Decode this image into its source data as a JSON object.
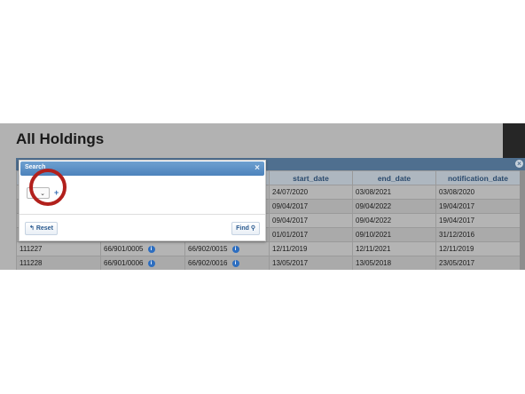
{
  "page": {
    "title": "All Holdings"
  },
  "grid": {
    "headers": [
      "",
      "",
      "",
      "start_date",
      "end_date",
      "notification_date"
    ],
    "rows": [
      [
        "",
        "",
        "",
        "24/07/2020",
        "03/08/2021",
        "03/08/2020"
      ],
      [
        "",
        "",
        "",
        "09/04/2017",
        "09/04/2022",
        "19/04/2017"
      ],
      [
        "",
        "",
        "",
        "09/04/2017",
        "09/04/2022",
        "19/04/2017"
      ],
      [
        "",
        "",
        "",
        "01/01/2017",
        "09/10/2021",
        "31/12/2016"
      ],
      [
        "111227",
        "66/901/0005",
        "66/902/0015",
        "12/11/2019",
        "12/11/2021",
        "12/11/2019"
      ],
      [
        "111228",
        "66/901/0006",
        "66/902/0016",
        "13/05/2017",
        "13/05/2018",
        "23/05/2017"
      ]
    ]
  },
  "search_dialog": {
    "title": "Search",
    "close_symbol": "×",
    "field_value": "a",
    "add_symbol": "+",
    "reset_icon": "↰",
    "reset_label": "Reset",
    "find_label": "Find",
    "find_icon": "⚲"
  },
  "icons": {
    "info_icon": "i",
    "chevron_down": "⌄"
  },
  "colors": {
    "highlight": "#b2201c",
    "titlebar": "#4d83bc"
  }
}
